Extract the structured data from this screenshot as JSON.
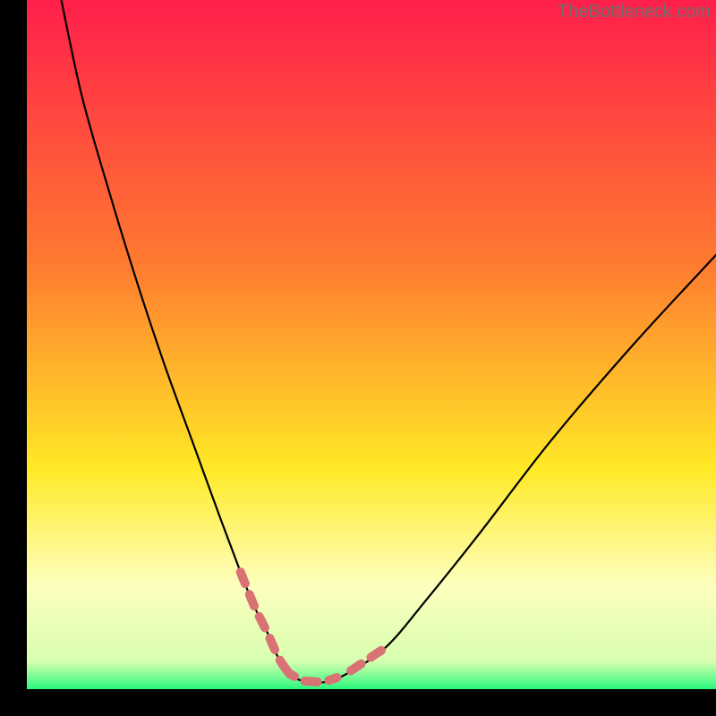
{
  "watermark": "TheBottleneck.com",
  "colors": {
    "gradient_top": "#ff1f4b",
    "gradient_mid1": "#ff7a30",
    "gradient_mid2_yellow": "#ffe926",
    "gradient_mid3_pale": "#fdffbe",
    "gradient_bottom_green": "#2bf87d",
    "curve": "#000000",
    "dash": "#d97373"
  },
  "chart_data": {
    "type": "line",
    "title": "",
    "xlabel": "",
    "ylabel": "",
    "xlim": [
      0,
      100
    ],
    "ylim": [
      0,
      100
    ],
    "series": [
      {
        "name": "curve",
        "x": [
          5,
          8,
          12,
          16,
          20,
          24,
          28,
          31,
          33,
          35,
          36.5,
          38,
          40,
          43,
          46,
          52,
          58,
          66,
          76,
          88,
          100
        ],
        "y": [
          100,
          86,
          72,
          59,
          47,
          36,
          25,
          17,
          12,
          8,
          4.5,
          2.3,
          1.2,
          1.0,
          2.0,
          6,
          13,
          23,
          36,
          50,
          63
        ]
      }
    ],
    "dash_segments": {
      "left": {
        "x_range": [
          31,
          37.5
        ],
        "along_curve": true
      },
      "floor": {
        "x_range": [
          37.5,
          45
        ],
        "along_curve": true
      },
      "right": {
        "x_range": [
          47,
          51.5
        ],
        "along_curve": true
      }
    }
  }
}
